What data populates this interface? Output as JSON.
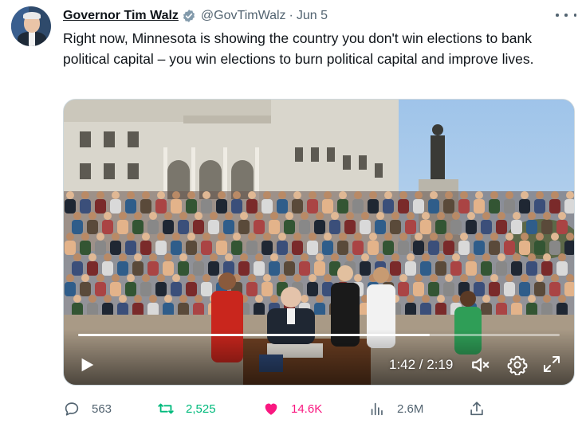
{
  "colors": {
    "text_primary": "#0f1419",
    "text_secondary": "#536471",
    "verified_badge": "#829aab",
    "retweet_active": "#00ba7c",
    "like_active": "#f91880"
  },
  "tweet": {
    "author_name": "Governor Tim Walz",
    "handle": "@GovTimWalz",
    "separator": "·",
    "date": "Jun 5",
    "text": "Right now, Minnesota is showing the country you don't win elections to bank political capital – you win elections to burn political capital and improve lives."
  },
  "video": {
    "time_label": "1:42 / 2:19",
    "progress": 0.73,
    "icons": [
      "play-icon",
      "volume-muted-icon",
      "gear-icon",
      "fullscreen-icon"
    ]
  },
  "actions": {
    "replies": "563",
    "retweets": "2,525",
    "likes": "14.6K",
    "views": "2.6M",
    "icons": [
      "reply-icon",
      "retweet-icon",
      "heart-icon",
      "views-icon",
      "share-icon"
    ]
  }
}
